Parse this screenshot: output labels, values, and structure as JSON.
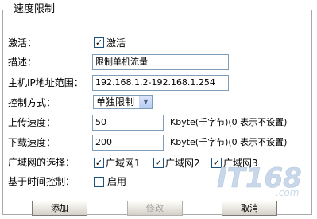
{
  "panel": {
    "title": "速度限制"
  },
  "fields": {
    "activate": {
      "label": "激活：",
      "checkbox_label": "激活",
      "checked": true
    },
    "description": {
      "label": "描述：",
      "value": "限制单机流量"
    },
    "ip_range": {
      "label": "主机IP地址范围：",
      "value": "192.168.1.2-192.168.1.254"
    },
    "control_mode": {
      "label": "控制方式：",
      "selected": "单独限制"
    },
    "upload_speed": {
      "label": "上传速度：",
      "value": "50",
      "hint": "Kbyte(千字节)(0 表示不设置)"
    },
    "download_speed": {
      "label": "下载速度：",
      "value": "200",
      "hint": "Kbyte(千字节)(0 表示不设置)"
    },
    "wan_select": {
      "label": "广域网的选择：",
      "options": [
        {
          "label": "广域网1",
          "checked": true
        },
        {
          "label": "广域网2",
          "checked": true
        },
        {
          "label": "广域网3",
          "checked": true
        }
      ]
    },
    "time_control": {
      "label": "基于时间控制：",
      "checkbox_label": "启用",
      "checked": false
    }
  },
  "buttons": {
    "add": "添加",
    "modify": "修改",
    "cancel": "取消"
  },
  "watermark": {
    "text": "IT168",
    "suffix": ".com"
  },
  "colors": {
    "field_border": "#7f9db9",
    "checkbox_border": "#1c5180",
    "disabled_text": "#a0a0a0",
    "watermark": "#c8d8ea"
  }
}
